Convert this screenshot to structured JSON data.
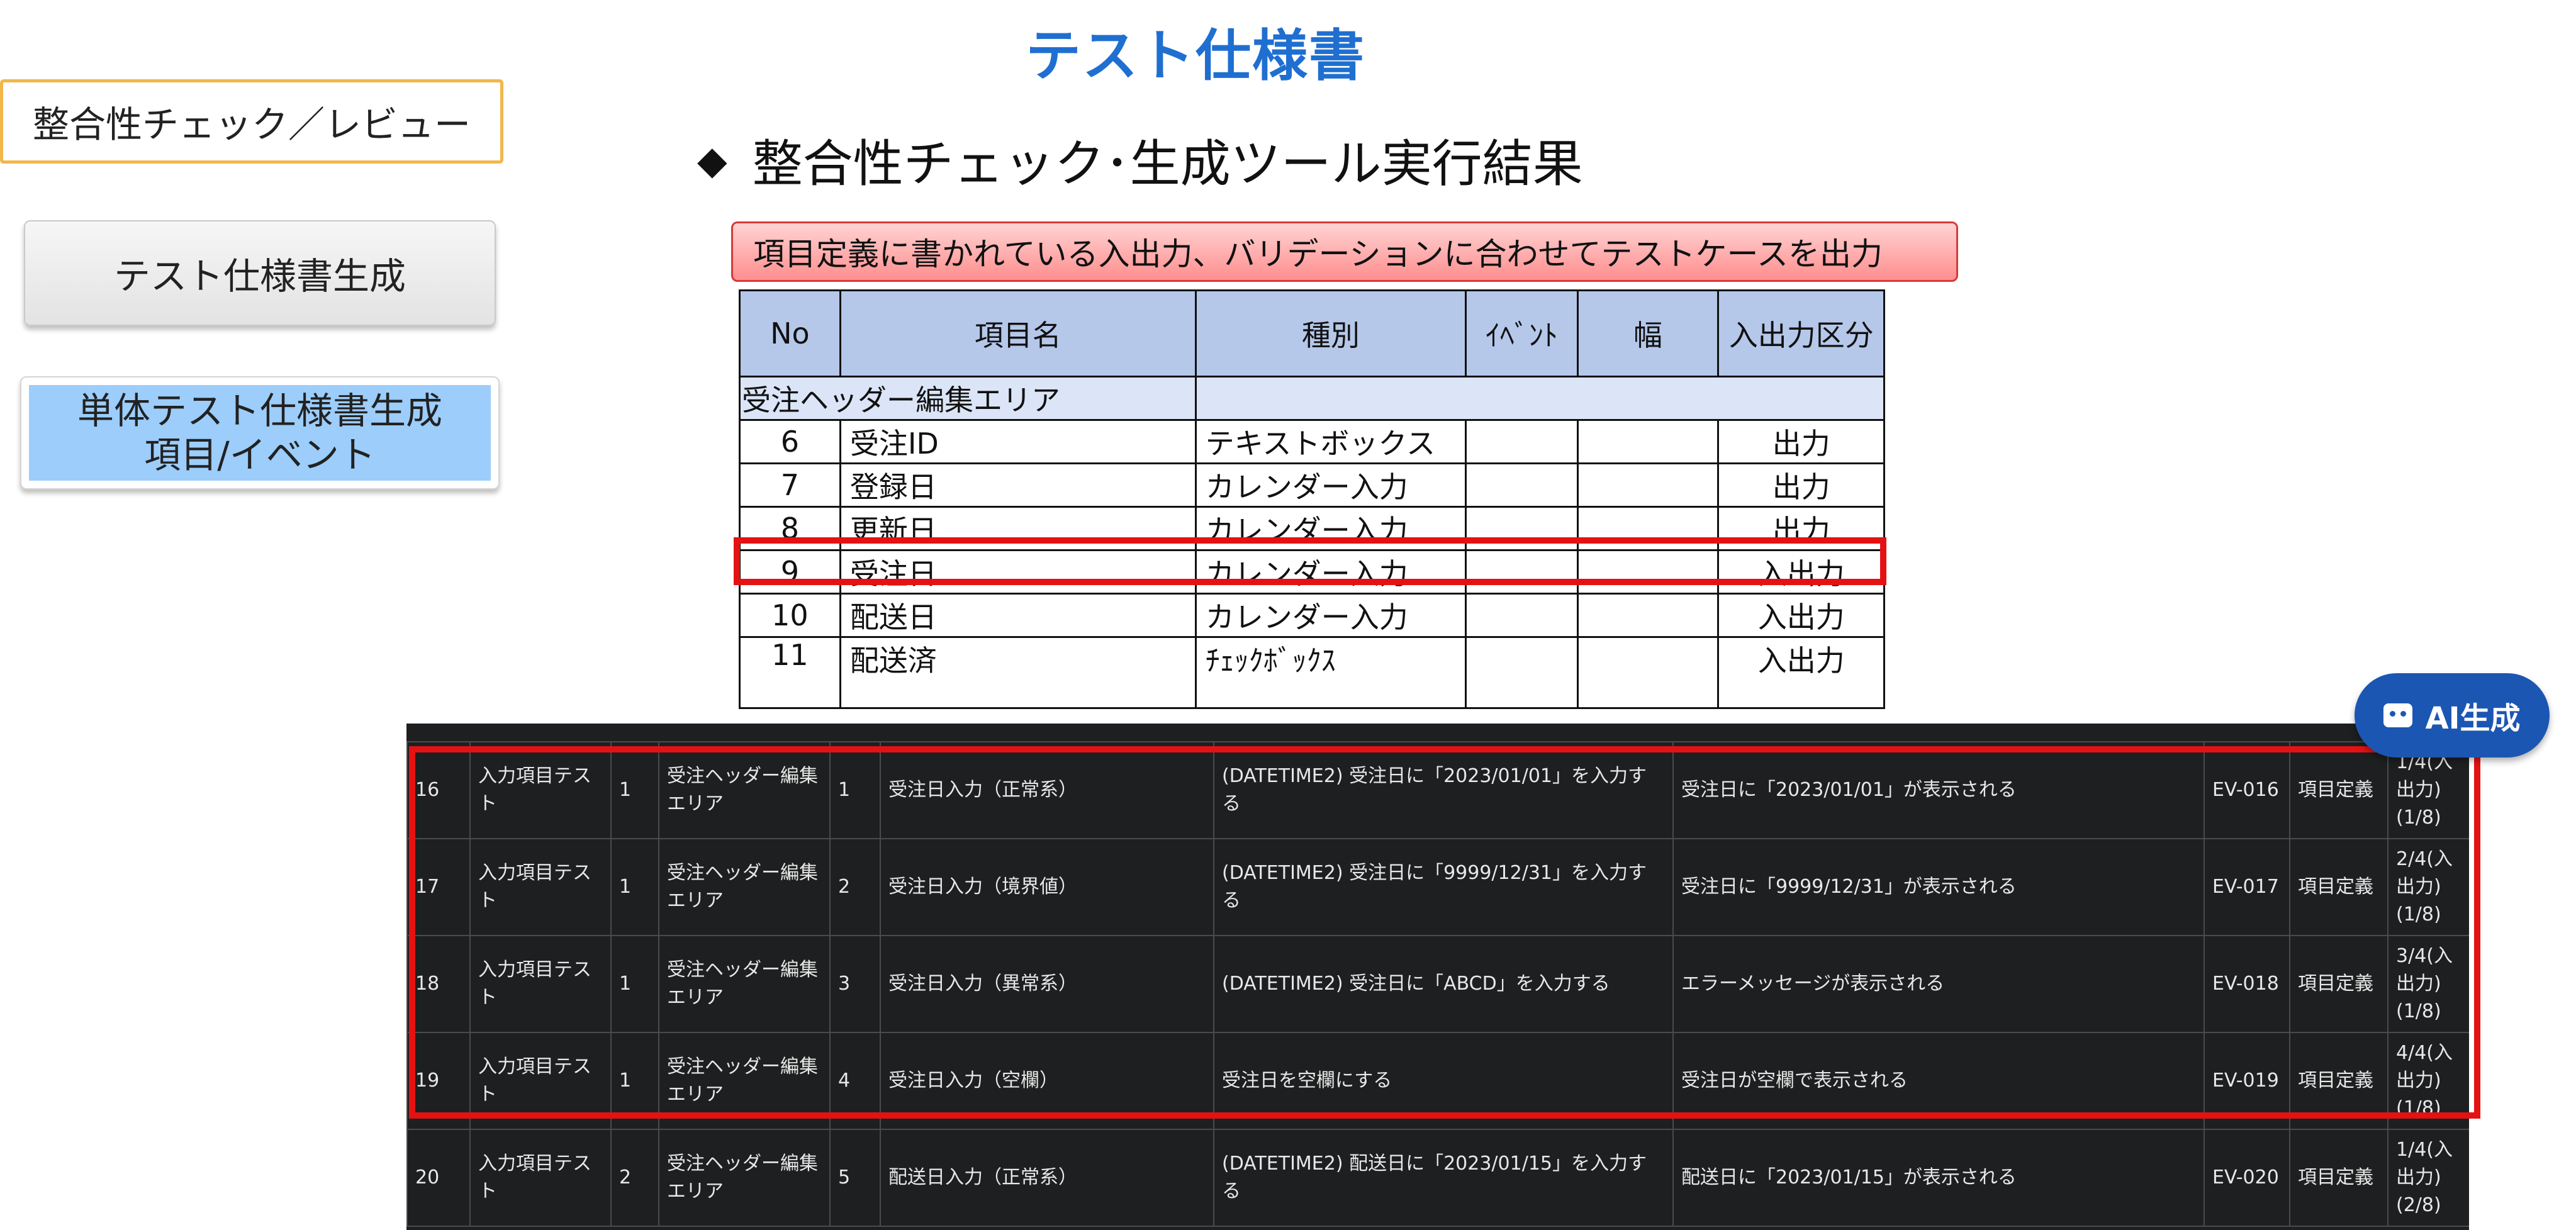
{
  "page": {
    "title": "テスト仕様書"
  },
  "sidebar": {
    "items": [
      {
        "label": "整合性チェック／レビュー"
      },
      {
        "label": "テスト仕様書生成"
      },
      {
        "label_line1": "単体テスト仕様書生成",
        "label_line2": "項目/イベント"
      }
    ]
  },
  "section": {
    "heading": "整合性チェック･生成ツール実行結果",
    "bullet": "◆"
  },
  "callout": {
    "text": "項目定義に書かれている入出力、バリデーションに合わせてテストケースを出力"
  },
  "definition_table": {
    "headers": [
      "No",
      "項目名",
      "種別",
      "ｲﾍﾞﾝﾄ",
      "幅",
      "入出力区分"
    ],
    "group_label": "受注ヘッダー編集エリア",
    "rows": [
      {
        "no": "6",
        "name": "受注ID",
        "type": "テキストボックス",
        "event": "",
        "width": "",
        "io": "出力"
      },
      {
        "no": "7",
        "name": "登録日",
        "type": "カレンダー入力",
        "event": "",
        "width": "",
        "io": "出力"
      },
      {
        "no": "8",
        "name": "更新日",
        "type": "カレンダー入力",
        "event": "",
        "width": "",
        "io": "出力"
      },
      {
        "no": "9",
        "name": "受注日",
        "type": "カレンダー入力",
        "event": "",
        "width": "",
        "io": "入出力"
      },
      {
        "no": "10",
        "name": "配送日",
        "type": "カレンダー入力",
        "event": "",
        "width": "",
        "io": "入出力"
      },
      {
        "no": "11",
        "name": "配送済",
        "type": "ﾁｪｯｸﾎﾞｯｸｽ",
        "event": "",
        "width": "",
        "io": "入出力"
      }
    ]
  },
  "ai_button": {
    "label": "AI生成"
  },
  "test_cases": [
    {
      "no": "16",
      "category": "入力項目テスト",
      "g": "1",
      "area": "受注ヘッダー編集エリア",
      "seq": "1",
      "title": "受注日入力（正常系）",
      "action": "(DATETIME2) 受注日に「2023/01/01」を入力する",
      "expected": "受注日に「2023/01/01」が表示される",
      "ev": "EV-016",
      "src": "項目定義",
      "note": "1/4(入出力)(1/8)"
    },
    {
      "no": "17",
      "category": "入力項目テスト",
      "g": "1",
      "area": "受注ヘッダー編集エリア",
      "seq": "2",
      "title": "受注日入力（境界値）",
      "action": "(DATETIME2) 受注日に「9999/12/31」を入力する",
      "expected": "受注日に「9999/12/31」が表示される",
      "ev": "EV-017",
      "src": "項目定義",
      "note": "2/4(入出力)(1/8)"
    },
    {
      "no": "18",
      "category": "入力項目テスト",
      "g": "1",
      "area": "受注ヘッダー編集エリア",
      "seq": "3",
      "title": "受注日入力（異常系）",
      "action": "(DATETIME2) 受注日に「ABCD」を入力する",
      "expected": "エラーメッセージが表示される",
      "ev": "EV-018",
      "src": "項目定義",
      "note": "3/4(入出力)(1/8)"
    },
    {
      "no": "19",
      "category": "入力項目テスト",
      "g": "1",
      "area": "受注ヘッダー編集エリア",
      "seq": "4",
      "title": "受注日入力（空欄）",
      "action": "受注日を空欄にする",
      "expected": "受注日が空欄で表示される",
      "ev": "EV-019",
      "src": "項目定義",
      "note": "4/4(入出力)(1/8)"
    },
    {
      "no": "20",
      "category": "入力項目テスト",
      "g": "2",
      "area": "受注ヘッダー編集エリア",
      "seq": "5",
      "title": "配送日入力（正常系）",
      "action": "(DATETIME2) 配送日に「2023/01/15」を入力する",
      "expected": "配送日に「2023/01/15」が表示される",
      "ev": "EV-020",
      "src": "項目定義",
      "note": "1/4(入出力)(2/8)"
    }
  ]
}
